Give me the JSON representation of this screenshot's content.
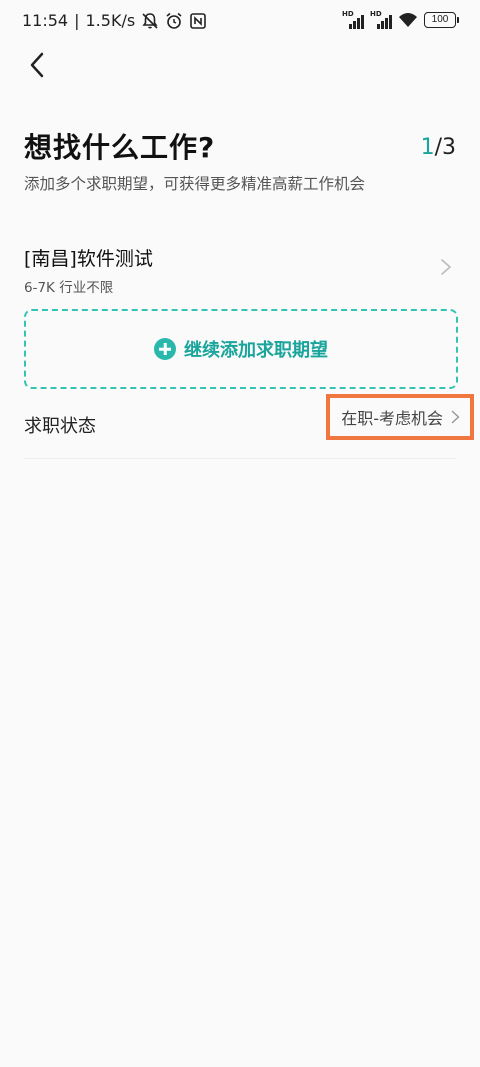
{
  "status_bar": {
    "time": "11:54",
    "speed": "1.5K/s",
    "network1": "HD",
    "network2": "HD",
    "battery": "100",
    "icons": [
      "mute-bell-icon",
      "alarm-icon",
      "nfc-icon",
      "signal-icon",
      "signal-icon",
      "wifi-icon",
      "battery-icon"
    ]
  },
  "header": {
    "back_icon": "chevron-left-icon",
    "title": "想找什么工作?",
    "step_current": "1",
    "step_total": "/3",
    "subtitle": "添加多个求职期望，可获得更多精准高薪工作机会"
  },
  "preferences": [
    {
      "title": "[南昌]软件测试",
      "desc": "6-7K 行业不限",
      "icon": "chevron-right-icon"
    }
  ],
  "add_button": {
    "label": "继续添加求职期望",
    "icon": "plus-circle-icon"
  },
  "job_status": {
    "label": "求职状态",
    "value": "在职-考虑机会",
    "icon": "chevron-right-icon"
  },
  "colors": {
    "accent": "#1aa59c",
    "dashed_border": "#35c3b6",
    "highlight": "#f07840"
  }
}
